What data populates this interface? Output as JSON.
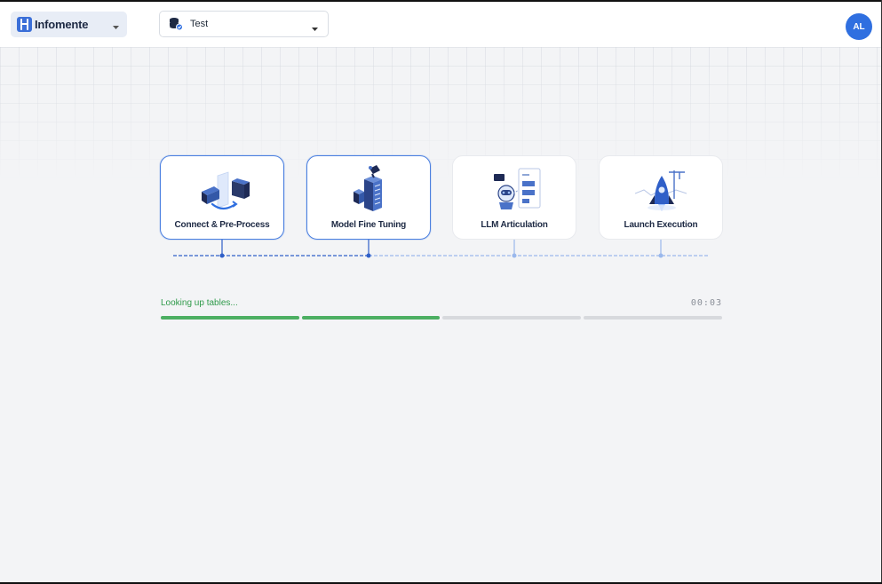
{
  "header": {
    "brand": {
      "name": "Infomente",
      "icon": "infomente-logo-icon"
    },
    "project": {
      "name": "Test",
      "icon": "database-check-icon"
    },
    "user": {
      "initials": "AL"
    }
  },
  "steps": [
    {
      "label": "Connect & Pre-Process",
      "active": true
    },
    {
      "label": "Model Fine Tuning",
      "active": true
    },
    {
      "label": "LLM Articulation",
      "active": false
    },
    {
      "label": "Launch Execution",
      "active": false
    }
  ],
  "progress": {
    "status": "Looking up tables...",
    "timer": "00:03",
    "segments": [
      1,
      1,
      0,
      0
    ]
  },
  "colors": {
    "accent": "#2f6fe0",
    "progress_done": "#4caf62",
    "progress_pending": "#d7d9dd",
    "status_text": "#2f9a4a"
  }
}
